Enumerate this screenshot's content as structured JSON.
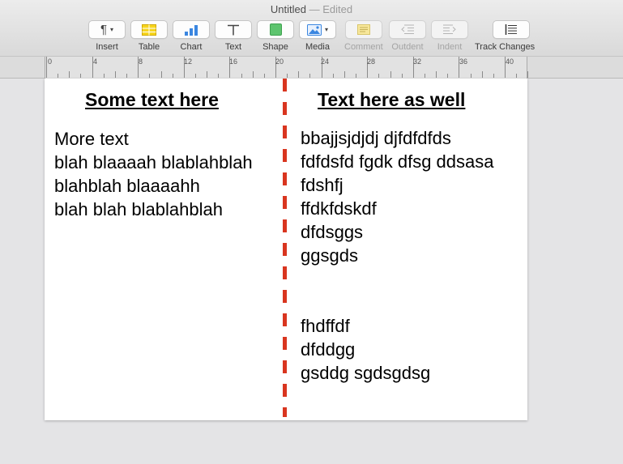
{
  "window": {
    "title": "Untitled",
    "edited": "— Edited"
  },
  "toolbar": [
    {
      "name": "insert-tool",
      "label": "Insert",
      "icon": "paragraph-icon",
      "enabled": true
    },
    {
      "name": "table-tool",
      "label": "Table",
      "icon": "table-icon",
      "enabled": true
    },
    {
      "name": "chart-tool",
      "label": "Chart",
      "icon": "chart-icon",
      "enabled": true
    },
    {
      "name": "text-tool",
      "label": "Text",
      "icon": "text-icon",
      "enabled": true
    },
    {
      "name": "shape-tool",
      "label": "Shape",
      "icon": "shape-icon",
      "enabled": true
    },
    {
      "name": "media-tool",
      "label": "Media",
      "icon": "media-icon",
      "enabled": true
    },
    {
      "name": "comment-tool",
      "label": "Comment",
      "icon": "comment-icon",
      "enabled": false
    },
    {
      "name": "outdent-tool",
      "label": "Outdent",
      "icon": "outdent-icon",
      "enabled": false
    },
    {
      "name": "indent-tool",
      "label": "Indent",
      "icon": "indent-icon",
      "enabled": false
    },
    {
      "name": "track-changes-tool",
      "label": "Track Changes",
      "icon": "track-changes-icon",
      "enabled": true
    }
  ],
  "ruler": {
    "labels": [
      "0",
      "4",
      "8",
      "12",
      "16",
      "20",
      "24",
      "28",
      "32",
      "36",
      "40"
    ]
  },
  "document": {
    "left_column": {
      "heading": "Some text here",
      "lines": [
        "More text",
        "blah blaaaah blablahblah",
        "blahblah blaaaahh",
        "blah blah blablahblah"
      ]
    },
    "right_column": {
      "heading": "Text here as well",
      "lines": [
        "bbajjsjdjdj djfdfdfds",
        "fdfdsfd fgdk dfsg ddsasa",
        "fdshfj",
        "ffdkfdskdf",
        "dfdsggs",
        "ggsgds",
        "",
        "",
        "fhdffdf",
        "dfddgg",
        "gsddg sgdsgdsg"
      ]
    },
    "divider_color": "#d9351f"
  }
}
